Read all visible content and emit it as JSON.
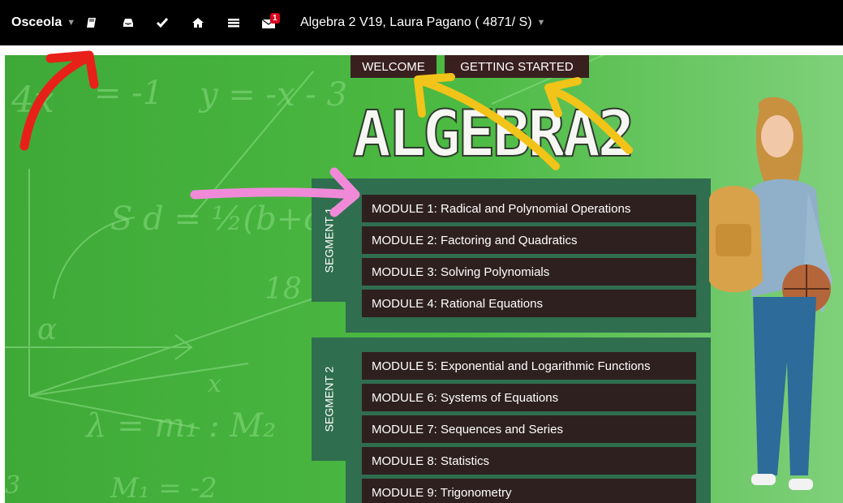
{
  "topbar": {
    "brand": "Osceola",
    "mail_badge": "1",
    "course_title": "Algebra 2 V19, Laura Pagano ( 4871/ S)",
    "icons": [
      "book-icon",
      "inbox-icon",
      "check-icon",
      "home-icon",
      "menu-icon",
      "mail-icon"
    ]
  },
  "nav": {
    "welcome": "WELCOME",
    "getting_started": "GETTING STARTED"
  },
  "logo_text": "ALGEBRA2",
  "segments": [
    {
      "label": "SEGMENT 1",
      "modules": [
        "MODULE 1: Radical and Polynomial Operations",
        "MODULE 2: Factoring and Quadratics",
        "MODULE 3: Solving Polynomials",
        "MODULE 4: Rational Equations"
      ]
    },
    {
      "label": "SEGMENT 2",
      "modules": [
        "MODULE 5: Exponential and Logarithmic Functions",
        "MODULE 6: Systems of Equations",
        "MODULE 7: Sequences and Series",
        "MODULE 8: Statistics",
        "MODULE 9: Trigonometry"
      ]
    }
  ],
  "colors": {
    "topbar": "#000000",
    "background_green": "#47b43f",
    "module_bg": "#2f2020",
    "segment_bg": "#2f6e4f",
    "annotation_red": "#e8201a",
    "annotation_yellow": "#f2c318",
    "annotation_pink": "#f08ad8"
  }
}
